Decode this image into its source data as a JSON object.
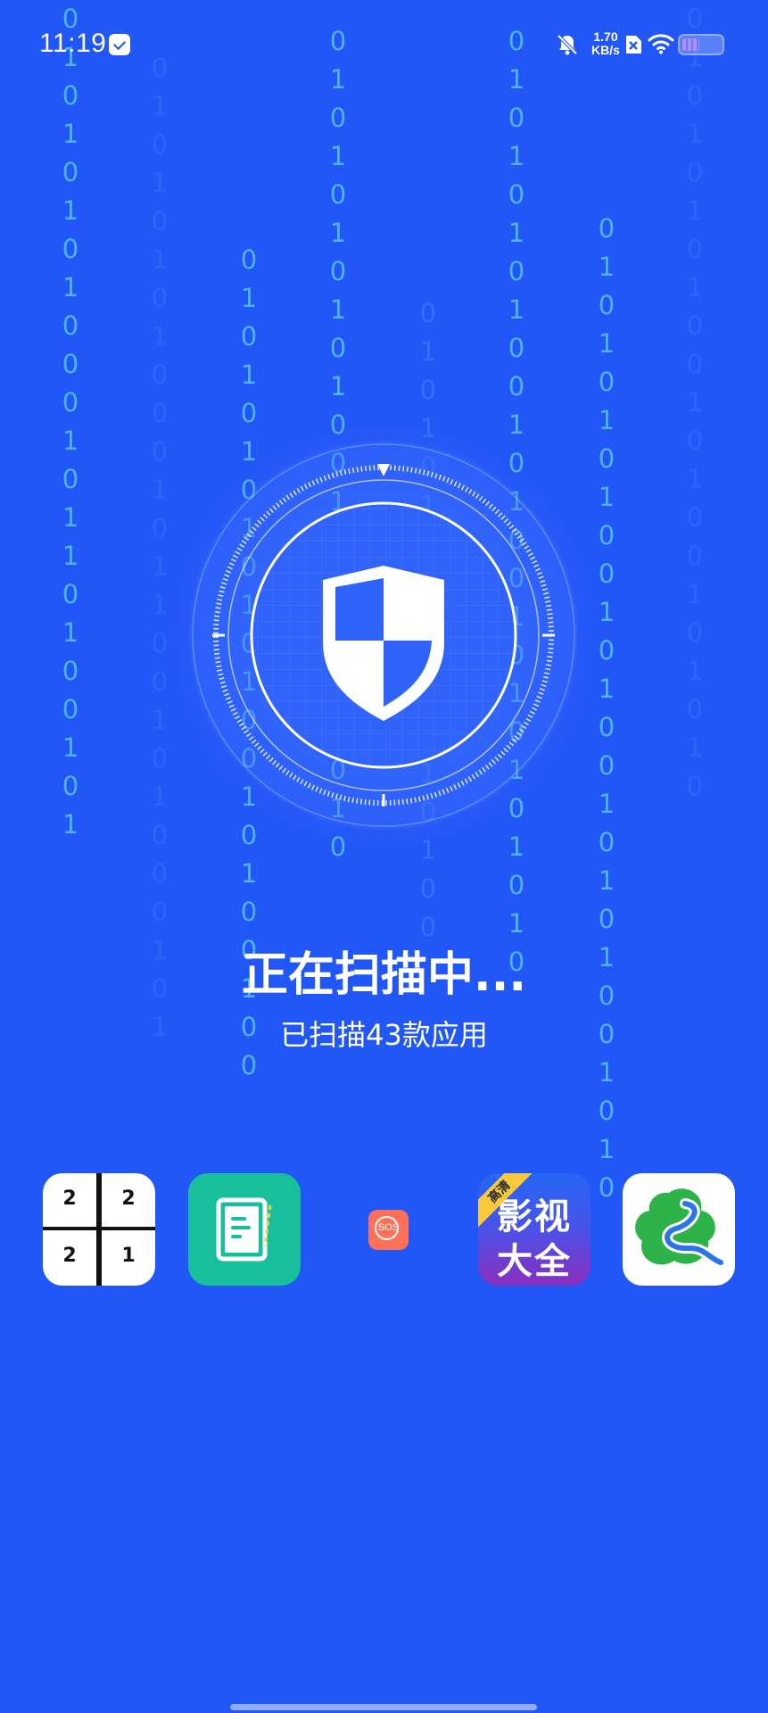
{
  "status_bar": {
    "time": "11:19",
    "net_speed_value": "1.70",
    "net_speed_unit": "KB/s",
    "icons": [
      "message-icon",
      "mute-bell-icon",
      "sim-off-icon",
      "wifi-icon",
      "battery-icon"
    ],
    "battery_level": 0.45
  },
  "scanner": {
    "icon": "shield-icon",
    "title": "正在扫描中...",
    "subtitle": "已扫描43款应用"
  },
  "apps": [
    {
      "name": "2048 grid app",
      "icon": "number-grid-icon",
      "cells": [
        "2",
        "2",
        "2",
        "1"
      ]
    },
    {
      "name": "notes app",
      "icon": "notepad-icon"
    },
    {
      "name": "sos app",
      "icon": "sos-icon",
      "label": "SOS"
    },
    {
      "name": "video app",
      "icon": "video-app-icon",
      "ribbon": "高清",
      "line1": "影视",
      "line2": "大全"
    },
    {
      "name": "map app",
      "icon": "map-leaf-icon"
    }
  ],
  "colors": {
    "background": "#2156F7",
    "binary_rain": "#4FB3FF",
    "text": "#FFFFFF"
  },
  "binary_rain": {
    "col_a": "0\n1\n0\n1\n0\n1\n0\n1\n0\n0\n0\n1\n0\n1\n1\n0\n1\n0\n0\n1\n0\n1",
    "col_b": "0\n1\n0\n1\n0\n1\n0\n1\n0\n0\n0\n1\n0\n1\n1\n0\n0\n1\n0\n1\n0\n0\n0\n1\n0\n1",
    "col_c": "0\n1\n0\n1\n0\n1\n0\n1\n0\n1\n0\n1\n0\n0\n1\n0\n1\n0\n0\n1\n0\n0",
    "col_d": "0\n1\n0\n1\n0\n1\n0\n1\n0\n1\n0\n0\n1\n0\n1\n0\n0\n1\n0\n0\n1\n0",
    "col_e": "0\n1\n0\n1\n0\n1\n0\n1\n0\n1\n0\n0\n1\n0\n1\n0\n0",
    "col_f": "0\n1\n0\n1\n0\n1\n0\n1\n0\n0\n1\n0\n1\n0\n0\n1\n0\n1\n0\n1\n0\n1\n0\n1\n0",
    "col_g": "0\n1\n0\n1\n0\n1\n0\n1\n0\n0\n1\n0\n1\n0\n0\n1\n0\n1\n0\n1\n0\n0\n1\n0\n1\n0",
    "col_h": "0\n1\n0\n1\n0\n1\n0\n1\n0\n0\n1\n0\n1\n0\n0\n1\n0\n1\n0\n1\n0"
  }
}
